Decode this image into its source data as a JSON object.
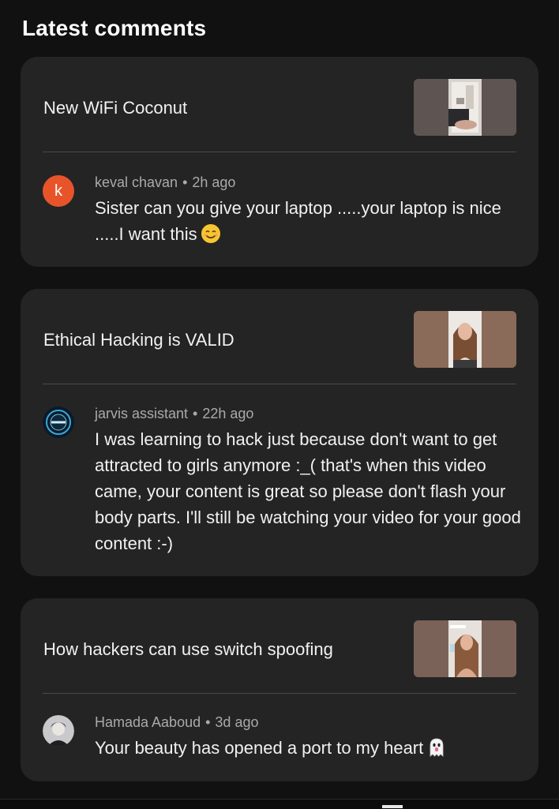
{
  "section": {
    "title": "Latest comments"
  },
  "cards": [
    {
      "video_title": "New WiFi Coconut",
      "comment": {
        "author": "keval chavan",
        "time": "2h ago",
        "avatar_letter": "k",
        "text": "Sister can you give your laptop .....your laptop is nice .....I want this",
        "emoji": "smiling-face-icon"
      }
    },
    {
      "video_title": "Ethical Hacking is VALID",
      "comment": {
        "author": "jarvis assistant",
        "time": "22h ago",
        "text": "I was learning to hack just because don't want to get attracted to girls anymore :_(  that's when this video came,  your content is great so please don't flash your body parts. I'll still be watching your video for your good content  :-)"
      }
    },
    {
      "video_title": "How hackers can use switch spoofing",
      "comment": {
        "author": "Hamada Aaboud",
        "time": "3d ago",
        "text": "Your beauty has opened a port to my heart",
        "emoji": "ghost-icon"
      }
    }
  ],
  "separator": "•",
  "colors": {
    "background": "#111111",
    "card": "#242424",
    "text_primary": "#f1f1f1",
    "text_secondary": "#aaaaaa",
    "avatar_orange": "#e8542a"
  }
}
